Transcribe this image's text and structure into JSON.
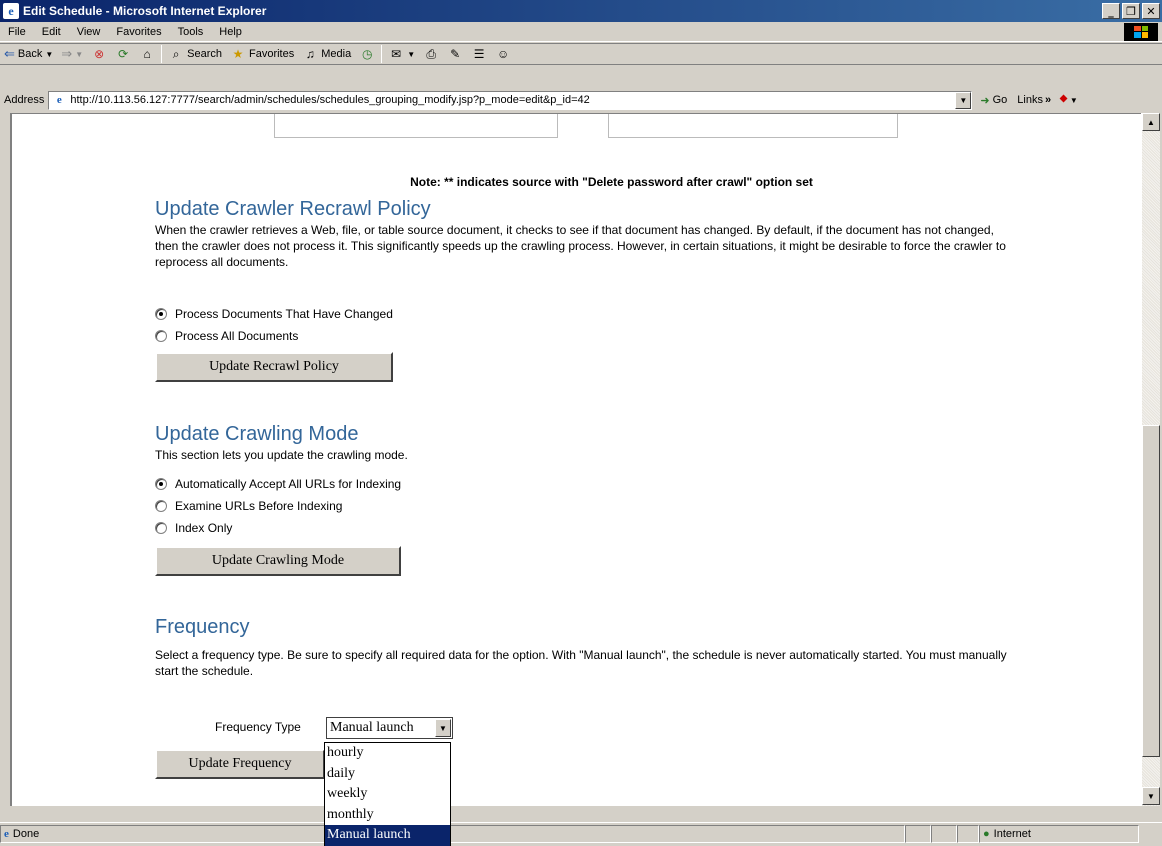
{
  "window": {
    "title": "Edit Schedule - Microsoft Internet Explorer"
  },
  "menu": [
    "File",
    "Edit",
    "View",
    "Favorites",
    "Tools",
    "Help"
  ],
  "toolbar": {
    "back": "Back",
    "search": "Search",
    "favorites": "Favorites",
    "media": "Media"
  },
  "address": {
    "label": "Address",
    "url": "http://10.113.56.127:7777/search/admin/schedules/schedules_grouping_modify.jsp?p_mode=edit&p_id=42",
    "go": "Go",
    "links": "Links"
  },
  "note": "Note: ** indicates source with \"Delete password after crawl\" option set",
  "recrawl": {
    "heading": "Update Crawler Recrawl Policy",
    "description": "When the crawler retrieves a Web, file, or table source document, it checks to see if that document has changed. By default, if the document has not changed, then the crawler does not process it. This significantly speeds up the crawling process. However, in certain situations, it might be desirable to force the crawler to reprocess all documents.",
    "options": [
      {
        "label": "Process Documents That Have Changed",
        "checked": true
      },
      {
        "label": "Process All Documents",
        "checked": false
      }
    ],
    "button": "Update Recrawl Policy"
  },
  "crawling": {
    "heading": "Update Crawling Mode",
    "description": "This section lets you update the crawling mode.",
    "options": [
      {
        "label": "Automatically Accept All URLs for Indexing",
        "checked": true
      },
      {
        "label": "Examine URLs Before Indexing",
        "checked": false
      },
      {
        "label": "Index Only",
        "checked": false
      }
    ],
    "button": "Update Crawling Mode"
  },
  "frequency": {
    "heading": "Frequency",
    "description": "Select a frequency type. Be sure to specify all required data for the option. With \"Manual launch\", the schedule is never automatically started. You must manually start the schedule.",
    "type_label": "Frequency Type",
    "selected": "Manual launch",
    "options": [
      "hourly",
      "daily",
      "weekly",
      "monthly",
      "Manual launch"
    ],
    "button": "Update Frequency"
  },
  "status": {
    "text": "Done",
    "zone": "Internet"
  }
}
